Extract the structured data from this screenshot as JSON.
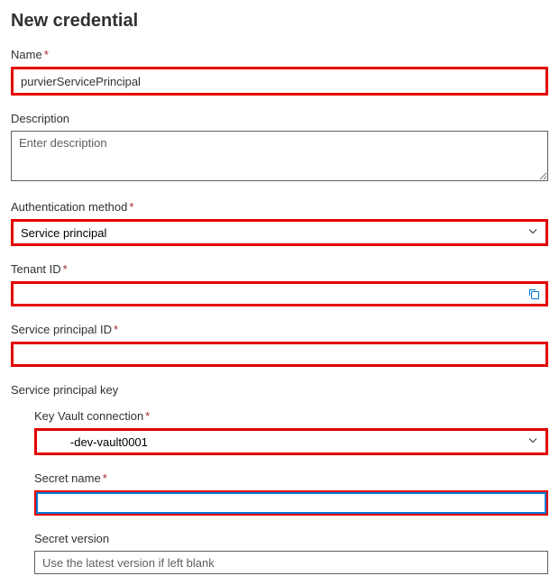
{
  "title": "New credential",
  "fields": {
    "name": {
      "label": "Name",
      "value": "purvierServicePrincipal"
    },
    "description": {
      "label": "Description",
      "placeholder": "Enter description"
    },
    "authMethod": {
      "label": "Authentication method",
      "value": "Service principal"
    },
    "tenantId": {
      "label": "Tenant ID",
      "value": ""
    },
    "spId": {
      "label": "Service principal ID",
      "value": ""
    },
    "spKey": {
      "label": "Service principal key"
    },
    "kvConn": {
      "label": "Key Vault connection",
      "value": "        -dev-vault0001"
    },
    "secretName": {
      "label": "Secret name",
      "value": ""
    },
    "secretVersion": {
      "label": "Secret version",
      "placeholder": "Use the latest version if left blank"
    }
  }
}
